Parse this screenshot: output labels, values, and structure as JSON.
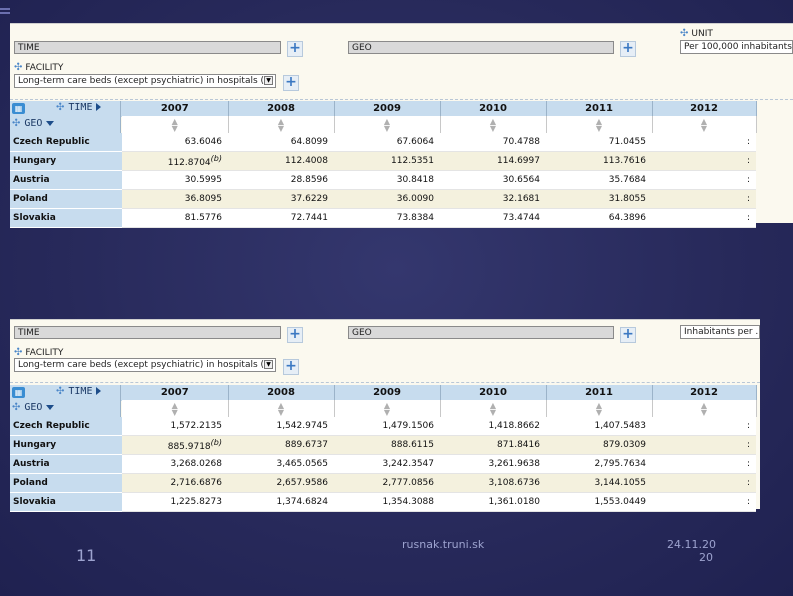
{
  "slide": {
    "page_number": "11",
    "footer_center": "rusnak.truni.sk",
    "date_line1": "24.11.20",
    "date_line2": "20"
  },
  "panels": [
    {
      "time_label": "TIME",
      "geo_label": "GEO",
      "unit_title": "UNIT",
      "unit_value": "Per 100,000 inhabitants",
      "facility_title": "FACILITY",
      "facility_value": "Long-term care beds (except psychiatric) in hospitals (",
      "axis_time": "TIME",
      "axis_geo": "GEO",
      "years": [
        "2007",
        "2008",
        "2009",
        "2010",
        "2011",
        "2012"
      ],
      "rows": [
        {
          "country": "Czech Republic",
          "values": [
            "63.6046",
            "64.8099",
            "67.6064",
            "70.4788",
            "71.0455",
            ":"
          ],
          "flag": ""
        },
        {
          "country": "Hungary",
          "values": [
            "112.8704",
            "112.4008",
            "112.5351",
            "114.6997",
            "113.7616",
            ":"
          ],
          "flag": "(b)"
        },
        {
          "country": "Austria",
          "values": [
            "30.5995",
            "28.8596",
            "30.8418",
            "30.6564",
            "35.7684",
            ":"
          ],
          "flag": ""
        },
        {
          "country": "Poland",
          "values": [
            "36.8095",
            "37.6229",
            "36.0090",
            "32.1681",
            "31.8055",
            ":"
          ],
          "flag": ""
        },
        {
          "country": "Slovakia",
          "values": [
            "81.5776",
            "72.7441",
            "73.8384",
            "73.4744",
            "64.3896",
            ":"
          ],
          "flag": ""
        }
      ]
    },
    {
      "time_label": "TIME",
      "geo_label": "GEO",
      "unit_value": "Inhabitants per ...",
      "facility_title": "FACILITY",
      "facility_value": "Long-term care beds (except psychiatric) in hospitals (",
      "axis_time": "TIME",
      "axis_geo": "GEO",
      "years": [
        "2007",
        "2008",
        "2009",
        "2010",
        "2011",
        "2012"
      ],
      "rows": [
        {
          "country": "Czech Republic",
          "values": [
            "1,572.2135",
            "1,542.9745",
            "1,479.1506",
            "1,418.8662",
            "1,407.5483",
            ":"
          ],
          "flag": ""
        },
        {
          "country": "Hungary",
          "values": [
            "885.9718",
            "889.6737",
            "888.6115",
            "871.8416",
            "879.0309",
            ":"
          ],
          "flag": "(b)"
        },
        {
          "country": "Austria",
          "values": [
            "3,268.0268",
            "3,465.0565",
            "3,242.3547",
            "3,261.9638",
            "2,795.7634",
            ":"
          ],
          "flag": ""
        },
        {
          "country": "Poland",
          "values": [
            "2,716.6876",
            "2,657.9586",
            "2,777.0856",
            "3,108.6736",
            "3,144.1055",
            ":"
          ],
          "flag": ""
        },
        {
          "country": "Slovakia",
          "values": [
            "1,225.8273",
            "1,374.6824",
            "1,354.3088",
            "1,361.0180",
            "1,553.0449",
            ":"
          ],
          "flag": ""
        }
      ]
    }
  ]
}
